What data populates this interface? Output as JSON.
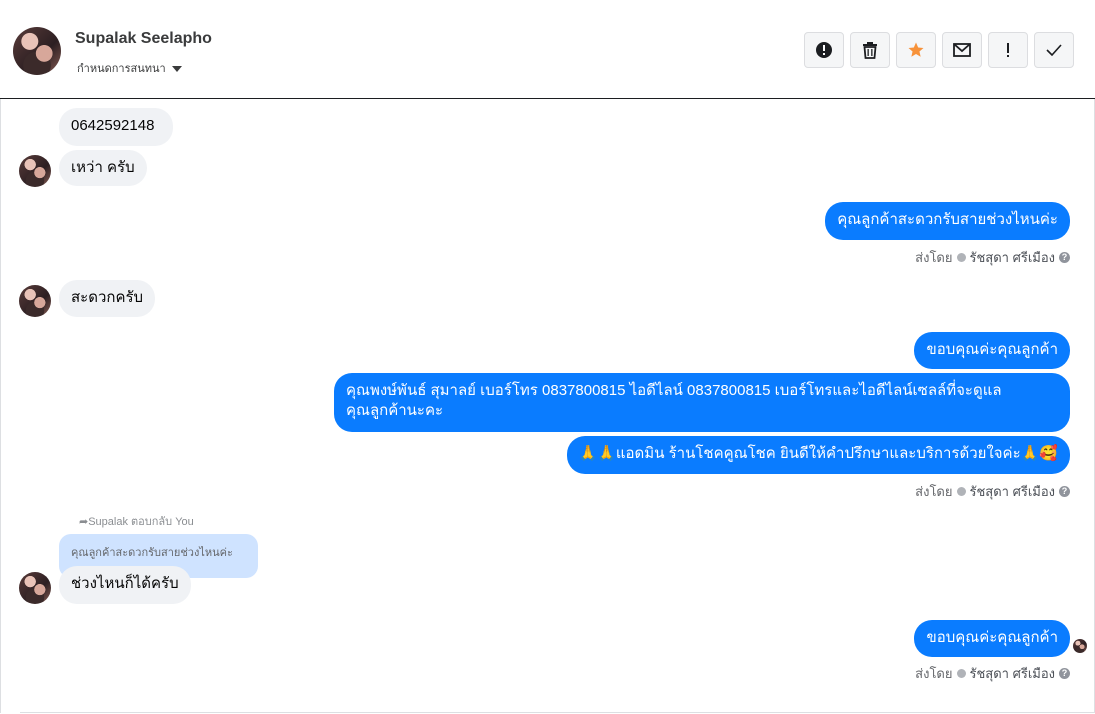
{
  "header": {
    "contact_name": "Supalak Seelapho",
    "subtitle": "กำหนดการสนทนา",
    "actions": [
      {
        "name": "report-button",
        "icon": "alert-circle-icon"
      },
      {
        "name": "delete-button",
        "icon": "trash-icon"
      },
      {
        "name": "star-button",
        "icon": "star-icon",
        "color": "#f7923a"
      },
      {
        "name": "mark-unread-button",
        "icon": "envelope-icon"
      },
      {
        "name": "important-button",
        "icon": "exclamation-icon"
      },
      {
        "name": "done-button",
        "icon": "check-icon"
      }
    ]
  },
  "messages": {
    "m1": "0642592148",
    "m2": "เหว่า ครับ",
    "m3": "คุณลูกค้าสะดวกรับสายช่วงไหนค่ะ",
    "m4": "สะดวกครับ",
    "m5": "ขอบคุณค่ะคุณลูกค้า",
    "m6_line1": "คุณพงษ์พันธ์ สุมาลย์      เบอร์โทร 0837800815  ไอดีไลน์ 0837800815   เบอร์โทรและไอดีไลน์เซลล์ที่จะดูแล",
    "m6_line2": "คุณลูกค้านะคะ",
    "m7": "🙏🙏แอดมิน ร้านโชคคูณโชค ยินดีให้คำปรึกษาและบริการด้วยใจค่ะ🙏🥰",
    "reply_header": "Supalak ตอบกลับ You",
    "quoted": "คุณลูกค้าสะดวกรับสายช่วงไหนค่ะ",
    "m8": "ช่วงไหนก็ได้ครับ",
    "m9": "ขอบคุณค่ะคุณลูกค้า"
  },
  "sent_by": {
    "label": "ส่งโดย",
    "agent": "รัชสุดา ศรีเมือง",
    "help": "?"
  },
  "colors": {
    "outgoing": "#0a7cff",
    "incoming": "#f0f2f5",
    "quoted": "#cfe3ff"
  }
}
